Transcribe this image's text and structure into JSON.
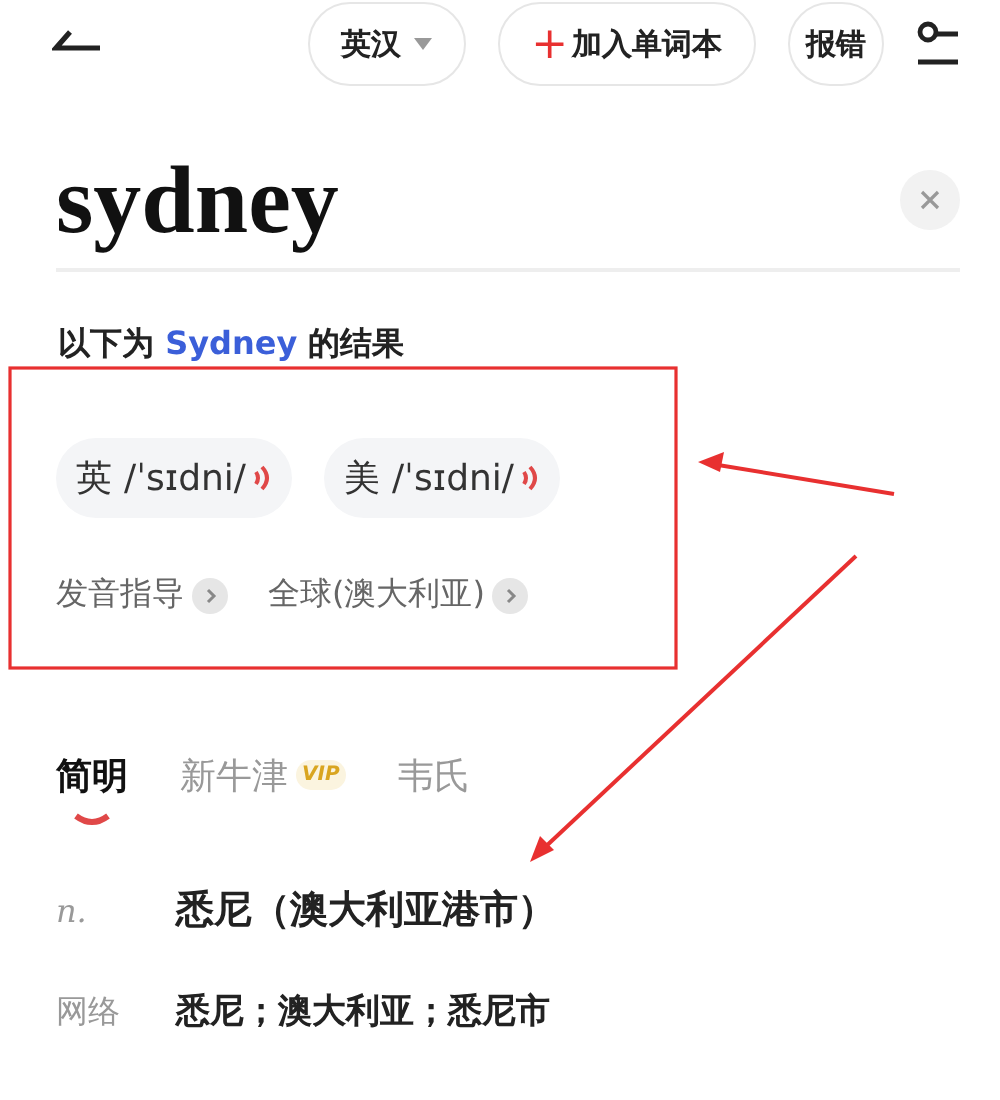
{
  "toolbar": {
    "language": "英汉",
    "add_button": {
      "icon": "+",
      "label": "加入单词本"
    },
    "report": "报错"
  },
  "search": {
    "value": "sydney"
  },
  "result": {
    "prefix": "以下为",
    "term": "Sydney",
    "suffix": "的结果"
  },
  "pronunciations": [
    {
      "region": "英",
      "phonetic": "/ˈsɪdni/"
    },
    {
      "region": "美",
      "phonetic": "/ˈsɪdni/"
    }
  ],
  "links": [
    "发音指导",
    "全球(澳大利亚)"
  ],
  "tabs": [
    {
      "label": "简明",
      "selected": true
    },
    {
      "label": "新牛津",
      "selected": false,
      "badge": "VIP"
    },
    {
      "label": "韦氏",
      "selected": false
    }
  ],
  "definitions": [
    {
      "kind": "pos",
      "label": "n.",
      "text": "悉尼（澳大利亚港市）"
    },
    {
      "kind": "web",
      "label": "网络",
      "text": "悉尼；澳大利亚；悉尼市"
    }
  ]
}
